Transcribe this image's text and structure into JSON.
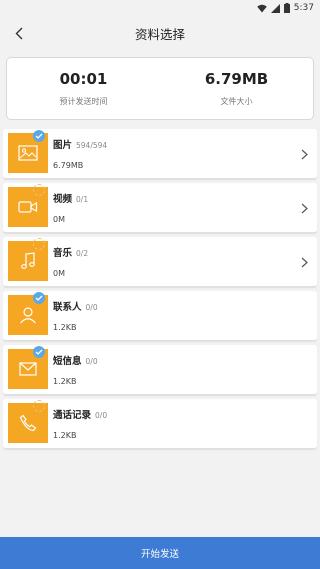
{
  "status_bar": {
    "time": "5:37"
  },
  "header": {
    "title": "资料选择"
  },
  "summary": {
    "time_value": "00:01",
    "time_label": "预计发送时间",
    "size_value": "6.79MB",
    "size_label": "文件大小"
  },
  "items": [
    {
      "name": "图片",
      "count": "594/594",
      "size": "6.79MB",
      "icon": "image-icon",
      "checked": true,
      "has_arrow": true
    },
    {
      "name": "视频",
      "count": "0/1",
      "size": "0M",
      "icon": "video-icon",
      "checked": false,
      "has_arrow": true
    },
    {
      "name": "音乐",
      "count": "0/2",
      "size": "0M",
      "icon": "music-icon",
      "checked": false,
      "has_arrow": true
    },
    {
      "name": "联系人",
      "count": "0/0",
      "size": "1.2KB",
      "icon": "contact-icon",
      "checked": true,
      "has_arrow": false
    },
    {
      "name": "短信息",
      "count": "0/0",
      "size": "1.2KB",
      "icon": "message-icon",
      "checked": true,
      "has_arrow": false
    },
    {
      "name": "通话记录",
      "count": "0/0",
      "size": "1.2KB",
      "icon": "phone-icon",
      "checked": false,
      "has_arrow": false
    }
  ],
  "footer": {
    "start_label": "开始发送"
  },
  "colors": {
    "accent": "#f5a623",
    "check": "#5aa9e6",
    "button": "#3e7bd4"
  }
}
